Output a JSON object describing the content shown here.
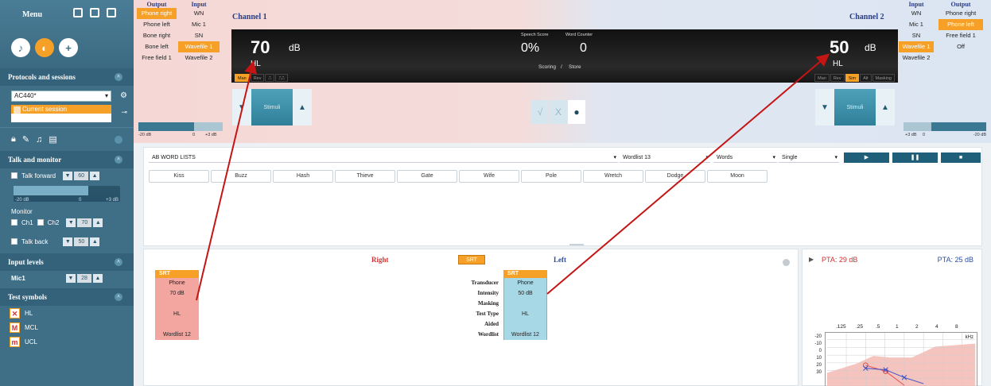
{
  "sidebar": {
    "menu_label": "Menu",
    "protocols": {
      "title": "Protocols and sessions",
      "protocol_value": "AC440*",
      "session_label": "Current session"
    },
    "talk_monitor": {
      "title": "Talk and monitor",
      "talk_forward_label": "Talk forward",
      "talk_forward_value": "60",
      "slider_min": "-20 dB",
      "slider_mid": "0",
      "slider_max": "+3 dB",
      "monitor_label": "Monitor",
      "ch1_label": "Ch1",
      "ch2_label": "Ch2",
      "monitor_value": "70",
      "talk_back_label": "Talk back",
      "talk_back_value": "50"
    },
    "input_levels": {
      "title": "Input levels",
      "mic_label": "Mic1",
      "mic_value": "28"
    },
    "test_symbols": {
      "title": "Test symbols",
      "items": [
        {
          "label": "HL",
          "icon": "hl-symbol-icon",
          "glyph": "✕"
        },
        {
          "label": "MCL",
          "icon": "mcl-symbol-icon",
          "glyph": "M"
        },
        {
          "label": "UCL",
          "icon": "ucl-symbol-icon",
          "glyph": "m"
        }
      ]
    }
  },
  "channel1": {
    "title": "Channel 1",
    "output_header": "Output",
    "input_header": "Input",
    "outputs": [
      "Phone right",
      "Phone left",
      "Bone right",
      "Bone left",
      "Free field 1"
    ],
    "inputs": [
      "WN",
      "Mic 1",
      "SN",
      "Wavefile 1",
      "Wavefile 2"
    ],
    "selected_output": "Phone right",
    "selected_input": "Wavefile 1",
    "value": "70",
    "unit": "dB",
    "scale": "HL",
    "modes": [
      "Man",
      "Rev",
      "⎍",
      "⎍⎍"
    ],
    "active_mode": "Man",
    "stim_label": "Stimuli",
    "slider": {
      "min": "-20 dB",
      "mid": "0",
      "max": "+3 dB"
    }
  },
  "channel2": {
    "title": "Channel 2",
    "output_header": "Output",
    "input_header": "Input",
    "outputs": [
      "Phone right",
      "Phone left",
      "Free field 1",
      "Off"
    ],
    "inputs": [
      "WN",
      "Mic 1",
      "SN",
      "Wavefile 1",
      "Wavefile 2"
    ],
    "selected_output": "Phone left",
    "selected_input": "Wavefile 1",
    "value": "50",
    "unit": "dB",
    "scale": "HL",
    "modes": [
      "Man",
      "Rev",
      "Sim",
      "Alt",
      "Masking"
    ],
    "active_mode": "Sim",
    "stim_label": "Stimuli",
    "slider": {
      "min": "+3 dB",
      "mid": "0",
      "max": "-20 dB"
    }
  },
  "center_display": {
    "speech_score_label": "Speech Score",
    "speech_score_value": "0%",
    "word_counter_label": "Word Counter",
    "word_counter_value": "0",
    "scoring_label": "Scoring",
    "store_label": "Store",
    "correct_glyph": "√",
    "wrong_glyph": "X",
    "dot_glyph": "●"
  },
  "words": {
    "list_name": "AB WORD LISTS",
    "wordlist": "Wordlist 13",
    "mode": "Words",
    "presentation": "Single",
    "items": [
      "Kiss",
      "Buzz",
      "Hash",
      "Thieve",
      "Gate",
      "Wife",
      "Pole",
      "Wretch",
      "Dodge",
      "Moon"
    ]
  },
  "results": {
    "right_title": "Right",
    "left_title": "Left",
    "srt_badge": "SRT",
    "srt_header": "SRT",
    "row_labels": [
      "Transducer",
      "Intensity",
      "Masking",
      "Test Type",
      "Aided",
      "Wordlist"
    ],
    "right_values": [
      "Phone",
      "70 dB",
      "",
      "HL",
      "",
      "Wordlist 12"
    ],
    "left_values": [
      "Phone",
      "50 dB",
      "",
      "HL",
      "",
      "Wordlist 12"
    ]
  },
  "audiogram": {
    "pta_right": "PTA:  29 dB",
    "pta_left": "PTA:  25 dB",
    "freq_labels": [
      ".125",
      ".25",
      ".5",
      "1",
      "2",
      "4",
      "8"
    ],
    "khz_label": "kHz",
    "y_labels": [
      "-20",
      "-10",
      "0",
      "10",
      "20",
      "30"
    ],
    "right_color": "#e05050",
    "left_color": "#3a4fc8"
  },
  "colors": {
    "accent": "#f6a028",
    "sidebar": "#3f6f86",
    "arrow": "#c41515"
  }
}
